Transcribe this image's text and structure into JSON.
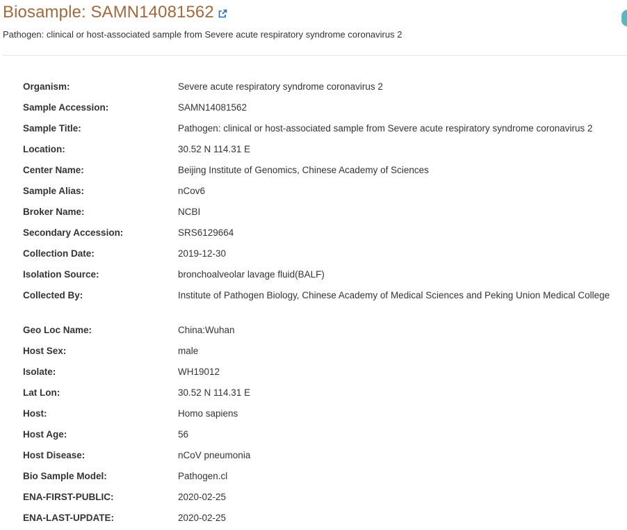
{
  "header": {
    "title": "Biosample: SAMN14081562",
    "subtitle": "Pathogen: clinical or host-associated sample from Severe acute respiratory syndrome coronavirus 2",
    "external_link_icon": "external-link-icon"
  },
  "colors": {
    "title": "#a06a3c",
    "link_icon": "#1f6fb2",
    "side_bubble": "#5ab6c0",
    "divider": "#e5e5e5"
  },
  "attributes": [
    {
      "label": "Organism:",
      "value": "Severe acute respiratory syndrome coronavirus 2"
    },
    {
      "label": "Sample Accession:",
      "value": "SAMN14081562"
    },
    {
      "label": "Sample Title:",
      "value": "Pathogen: clinical or host-associated sample from Severe acute respiratory syndrome coronavirus 2"
    },
    {
      "label": "Location:",
      "value": "30.52 N 114.31 E"
    },
    {
      "label": "Center Name:",
      "value": "Beijing Institute of Genomics, Chinese Academy of Sciences"
    },
    {
      "label": "Sample Alias:",
      "value": "nCov6"
    },
    {
      "label": "Broker Name:",
      "value": "NCBI"
    },
    {
      "label": "Secondary Accession:",
      "value": "SRS6129664"
    },
    {
      "label": "Collection Date:",
      "value": "2019-12-30"
    },
    {
      "label": "Isolation Source:",
      "value": "bronchoalveolar lavage fluid(BALF)"
    },
    {
      "label": "Collected By:",
      "value": "Institute of Pathogen Biology, Chinese Academy of Medical Sciences and Peking Union Medical College"
    },
    {
      "label": "Geo Loc Name:",
      "value": "China:Wuhan"
    },
    {
      "label": "Host Sex:",
      "value": "male"
    },
    {
      "label": "Isolate:",
      "value": "WH19012"
    },
    {
      "label": "Lat Lon:",
      "value": "30.52 N 114.31 E"
    },
    {
      "label": "Host:",
      "value": "Homo sapiens"
    },
    {
      "label": "Host Age:",
      "value": "56"
    },
    {
      "label": "Host Disease:",
      "value": "nCoV pneumonia"
    },
    {
      "label": "Bio Sample Model:",
      "value": "Pathogen.cl"
    },
    {
      "label": "ENA-FIRST-PUBLIC:",
      "value": "2020-02-25"
    },
    {
      "label": "ENA-LAST-UPDATE:",
      "value": "2020-02-25"
    }
  ]
}
